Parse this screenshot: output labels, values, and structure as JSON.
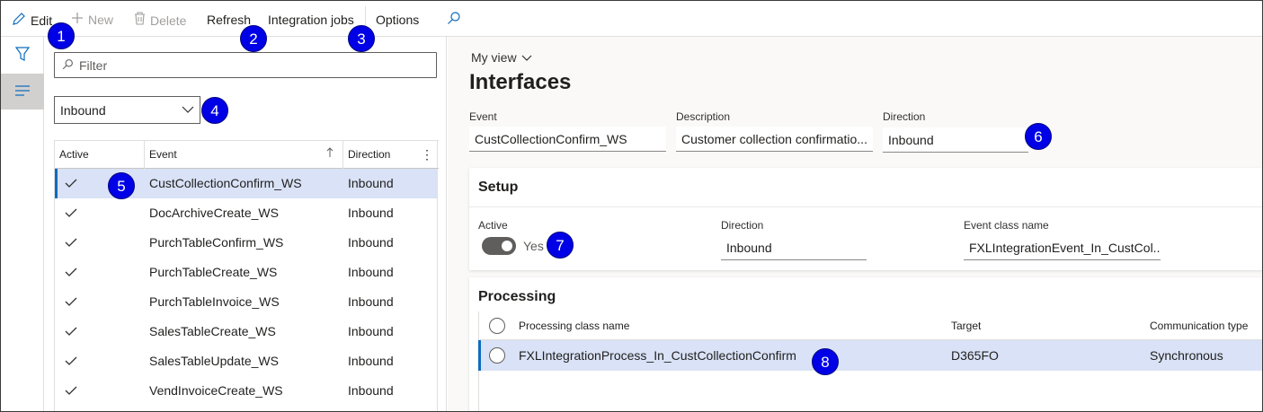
{
  "toolbar": {
    "edit": "Edit",
    "new": "New",
    "delete": "Delete",
    "refresh": "Refresh",
    "integration_jobs": "Integration jobs",
    "options": "Options"
  },
  "list": {
    "filter_placeholder": "Filter",
    "direction_selected": "Inbound",
    "columns": {
      "active": "Active",
      "event": "Event",
      "direction": "Direction"
    },
    "rows": [
      {
        "active": true,
        "event": "CustCollectionConfirm_WS",
        "direction": "Inbound",
        "selected": true
      },
      {
        "active": true,
        "event": "DocArchiveCreate_WS",
        "direction": "Inbound"
      },
      {
        "active": true,
        "event": "PurchTableConfirm_WS",
        "direction": "Inbound"
      },
      {
        "active": true,
        "event": "PurchTableCreate_WS",
        "direction": "Inbound"
      },
      {
        "active": true,
        "event": "PurchTableInvoice_WS",
        "direction": "Inbound"
      },
      {
        "active": true,
        "event": "SalesTableCreate_WS",
        "direction": "Inbound"
      },
      {
        "active": true,
        "event": "SalesTableUpdate_WS",
        "direction": "Inbound"
      },
      {
        "active": true,
        "event": "VendInvoiceCreate_WS",
        "direction": "Inbound"
      }
    ]
  },
  "detail": {
    "view_name": "My view",
    "title": "Interfaces",
    "header_fields": {
      "event_label": "Event",
      "event_value": "CustCollectionConfirm_WS",
      "description_label": "Description",
      "description_value": "Customer collection confirmatio...",
      "direction_label": "Direction",
      "direction_value": "Inbound"
    },
    "setup": {
      "title": "Setup",
      "active_label": "Active",
      "active_value": "Yes",
      "direction_label": "Direction",
      "direction_value": "Inbound",
      "event_class_label": "Event class name",
      "event_class_value": "FXLIntegrationEvent_In_CustCol..."
    },
    "processing": {
      "title": "Processing",
      "columns": {
        "class_name": "Processing class name",
        "target": "Target",
        "comm_type": "Communication type"
      },
      "rows": [
        {
          "class_name": "FXLIntegrationProcess_In_CustCollectionConfirm",
          "target": "D365FO",
          "comm_type": "Synchronous"
        }
      ]
    }
  },
  "callouts": [
    "1",
    "2",
    "3",
    "4",
    "5",
    "6",
    "7",
    "8"
  ],
  "colors": {
    "accent": "#0f6cbd",
    "selection": "#d9e2f6",
    "callout": "#0000e6"
  }
}
